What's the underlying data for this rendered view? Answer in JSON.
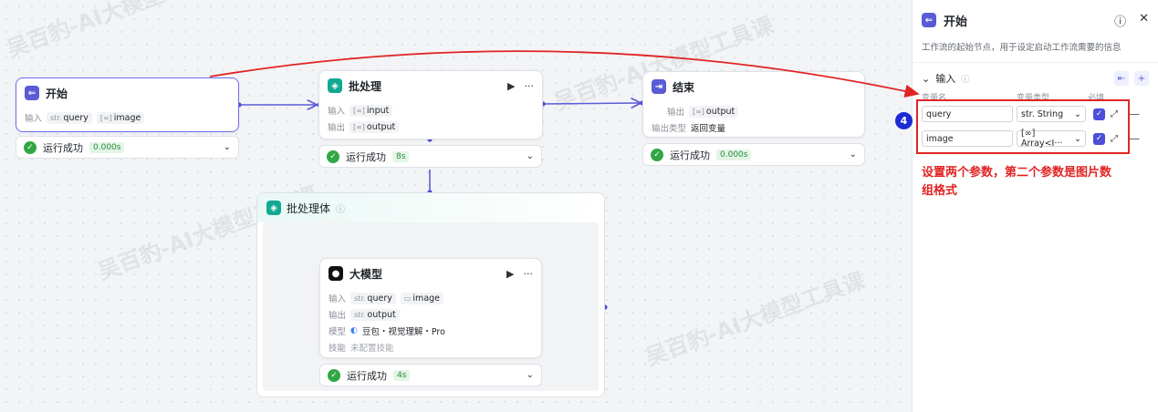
{
  "watermark": "吴百豹-AI大模型工具课",
  "nodes": {
    "start": {
      "title": "开始",
      "input_label": "输入",
      "inputs": [
        {
          "type": "str.",
          "name": "query"
        },
        {
          "type": "[∞]",
          "name": "image"
        }
      ],
      "status": "运行成功",
      "time": "0.000s"
    },
    "batch": {
      "title": "批处理",
      "input_label": "输入",
      "output_label": "输出",
      "input": {
        "type": "[∞]",
        "name": "input"
      },
      "output": {
        "type": "[∞]",
        "name": "output"
      },
      "status": "运行成功",
      "time": "8s"
    },
    "end": {
      "title": "结束",
      "output_label": "输出",
      "output": {
        "type": "[∞]",
        "name": "output"
      },
      "output_type_label": "输出类型",
      "output_type": "返回变量",
      "status": "运行成功",
      "time": "0.000s"
    },
    "batch_body": {
      "title": "批处理体"
    },
    "llm": {
      "title": "大模型",
      "input_label": "输入",
      "output_label": "输出",
      "model_label": "模型",
      "skill_label": "技能",
      "inputs": [
        {
          "type": "str.",
          "name": "query"
        },
        {
          "type": "▭",
          "name": "image"
        }
      ],
      "output": {
        "type": "str.",
        "name": "output"
      },
      "model": "豆包・视觉理解・Pro",
      "skill": "未配置技能",
      "status": "运行成功",
      "time": "4s"
    }
  },
  "panel": {
    "title": "开始",
    "description": "工作流的起始节点，用于设定启动工作流需要的信息",
    "section_label": "输入",
    "columns": [
      "变量名",
      "变量类型",
      "必填"
    ],
    "rows": [
      {
        "name": "query",
        "type": "str. String",
        "required": true
      },
      {
        "name": "image",
        "type": "[∞] Array<I···",
        "required": true
      }
    ]
  },
  "annotation": {
    "number": "4",
    "text": "设置两个参数，第二个参数是图片数组格式"
  },
  "colors": {
    "accent": "#5b5bd6",
    "success": "#32a645",
    "annotation": "#e02424"
  }
}
